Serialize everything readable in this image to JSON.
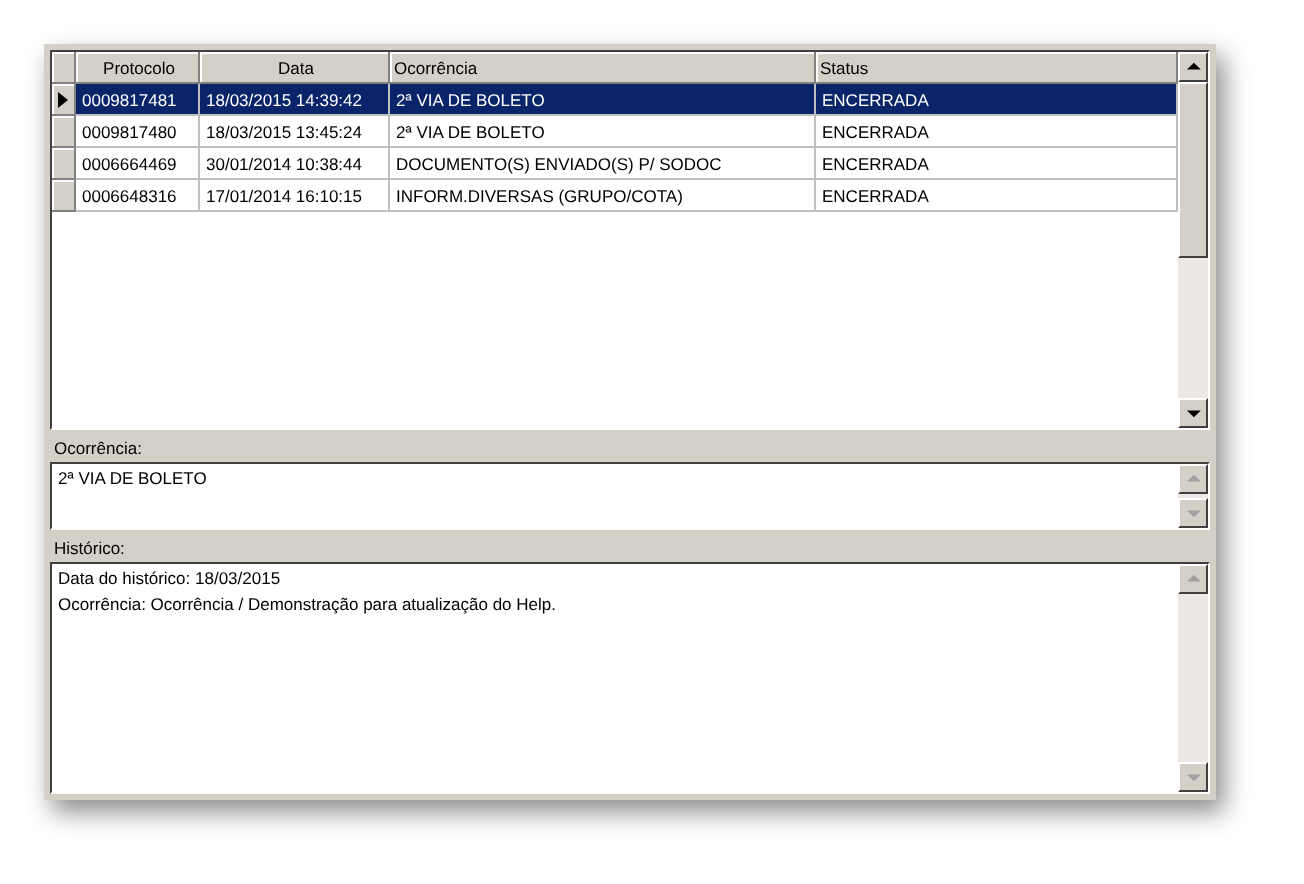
{
  "table": {
    "columns": [
      "Protocolo",
      "Data",
      "Ocorrência",
      "Status"
    ],
    "rows": [
      {
        "cells": [
          "0009817481",
          "18/03/2015 14:39:42",
          "2ª VIA DE BOLETO",
          "ENCERRADA"
        ],
        "selected": true
      },
      {
        "cells": [
          "0009817480",
          "18/03/2015 13:45:24",
          "2ª VIA DE BOLETO",
          "ENCERRADA"
        ],
        "selected": false
      },
      {
        "cells": [
          "0006664469",
          "30/01/2014 10:38:44",
          "DOCUMENTO(S) ENVIADO(S) P/ SODOC",
          "ENCERRADA"
        ],
        "selected": false
      },
      {
        "cells": [
          "0006648316",
          "17/01/2014 16:10:15",
          "INFORM.DIVERSAS (GRUPO/COTA)",
          "ENCERRADA"
        ],
        "selected": false
      }
    ]
  },
  "ocorrencia": {
    "label": "Ocorrência:",
    "lines": [
      "2ª VIA DE BOLETO"
    ]
  },
  "historico": {
    "label": "Histórico:",
    "lines": [
      "Data do histórico: 18/03/2015",
      "Ocorrência: Ocorrência / Demonstração para atualização do Help."
    ]
  }
}
